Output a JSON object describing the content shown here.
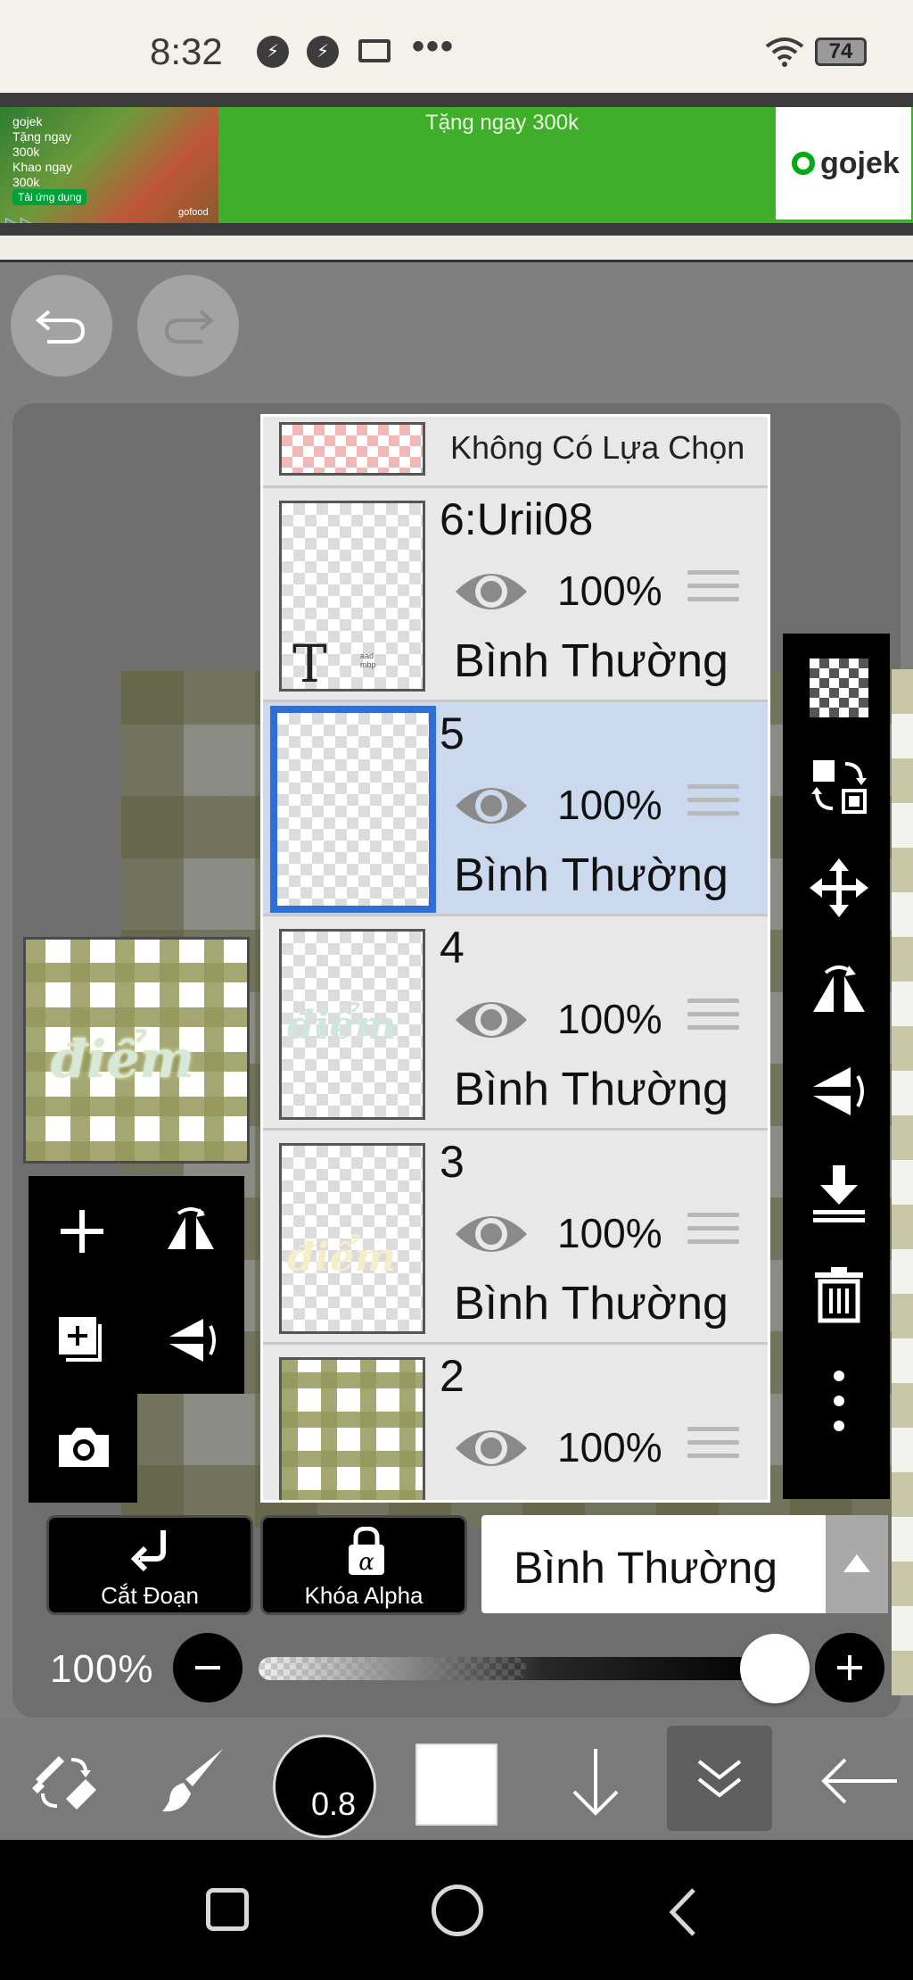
{
  "status_bar": {
    "time": "8:32",
    "battery": "74",
    "icons": [
      "messenger-icon",
      "messenger-icon",
      "screen-cast-icon",
      "more-dots-icon",
      "wifi-icon",
      "battery-icon"
    ]
  },
  "ad": {
    "text": "Tặng ngay 300k",
    "brand": "gojek",
    "image_text": "gojek\nTặng ngay\n300k\nKhao ngay\n300k",
    "image_button": "Tải ứng dụng",
    "image_footer": "gofood"
  },
  "history": {
    "undo_icon": "undo-icon",
    "redo_icon": "redo-icon"
  },
  "layers_panel": {
    "top_row_label": "Không Có Lựa Chọn",
    "layers": [
      {
        "name": "6:Urii08",
        "opacity": "100%",
        "blend": "Bình Thường",
        "selected": false,
        "thumb_glyph": "T",
        "thumb_small": "aad\nmbp"
      },
      {
        "name": "5",
        "opacity": "100%",
        "blend": "Bình Thường",
        "selected": true
      },
      {
        "name": "4",
        "opacity": "100%",
        "blend": "Bình Thường",
        "selected": false,
        "thumb_word": "điểm"
      },
      {
        "name": "3",
        "opacity": "100%",
        "blend": "Bình Thường",
        "selected": false,
        "thumb_word": "điểm"
      },
      {
        "name": "2",
        "opacity": "100%",
        "blend": "Bình Thường",
        "selected": false
      }
    ]
  },
  "canvas": {
    "thumb_word": "điểm"
  },
  "actions": {
    "clipping_label": "Cắt Đoạn",
    "alpha_lock_label": "Khóa Alpha",
    "alpha_glyph": "α",
    "blend_mode": "Bình Thường"
  },
  "opacity": {
    "label": "100%",
    "value": 1.0
  },
  "brush": {
    "size": "0.8"
  },
  "colors": {
    "accent_selected": "#2f6ed6",
    "selected_row": "#cbd9ee",
    "ad_green": "#3fae2a"
  }
}
